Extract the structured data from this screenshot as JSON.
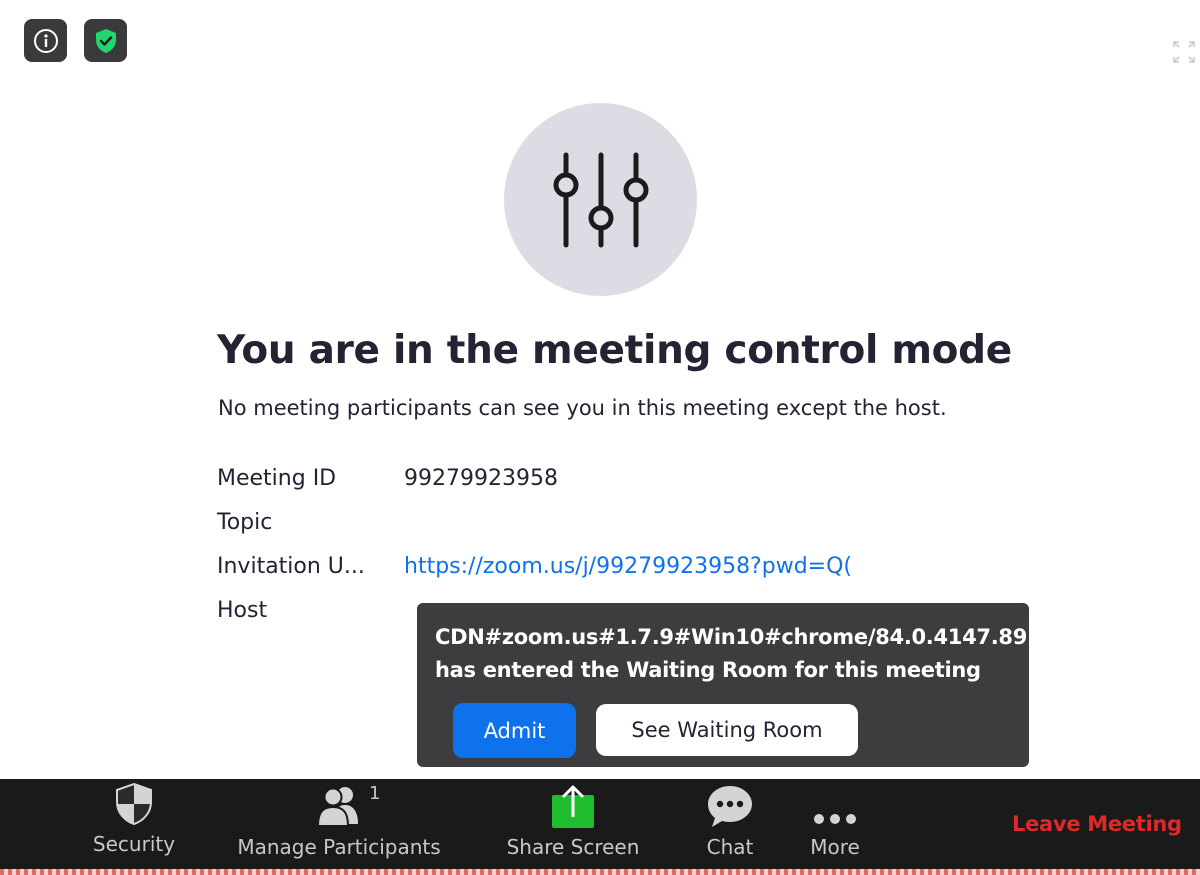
{
  "title": "You are in the meeting control mode",
  "subtitle": "No meeting participants can see you in this meeting except the host.",
  "meeting_info": {
    "meeting_id_label": "Meeting ID",
    "meeting_id_value": "99279923958",
    "topic_label": "Topic",
    "topic_value": "",
    "invitation_label": "Invitation U...",
    "invitation_value": "https://zoom.us/j/99279923958?pwd=Q(",
    "host_label": "Host"
  },
  "waiting_room_popup": {
    "message": "CDN#zoom.us#1.7.9#Win10#chrome/84.0.4147.89 has entered the Waiting Room for this meeting",
    "admit_label": "Admit",
    "see_waiting_room_label": "See Waiting Room"
  },
  "toolbar": {
    "security_label": "Security",
    "participants_label": "Manage Participants",
    "participant_count": "1",
    "share_label": "Share Screen",
    "chat_label": "Chat",
    "more_label": "More",
    "leave_label": "Leave Meeting"
  },
  "icons": {
    "top_left": [
      "info-icon",
      "shield-check-icon"
    ],
    "top_right": "fullscreen-icon",
    "hero": "sliders-icon",
    "toolbar": [
      "security-shield-icon",
      "participants-icon",
      "share-screen-icon",
      "chat-bubble-icon",
      "more-dots-icon"
    ]
  },
  "colors": {
    "accent_blue": "#0e72ed",
    "leave_red": "#e02828",
    "share_green": "#1dbd2e",
    "shield_green": "#24d66b",
    "toolbar_bg": "#1a1a1a",
    "popup_bg": "#3d3d3f"
  }
}
